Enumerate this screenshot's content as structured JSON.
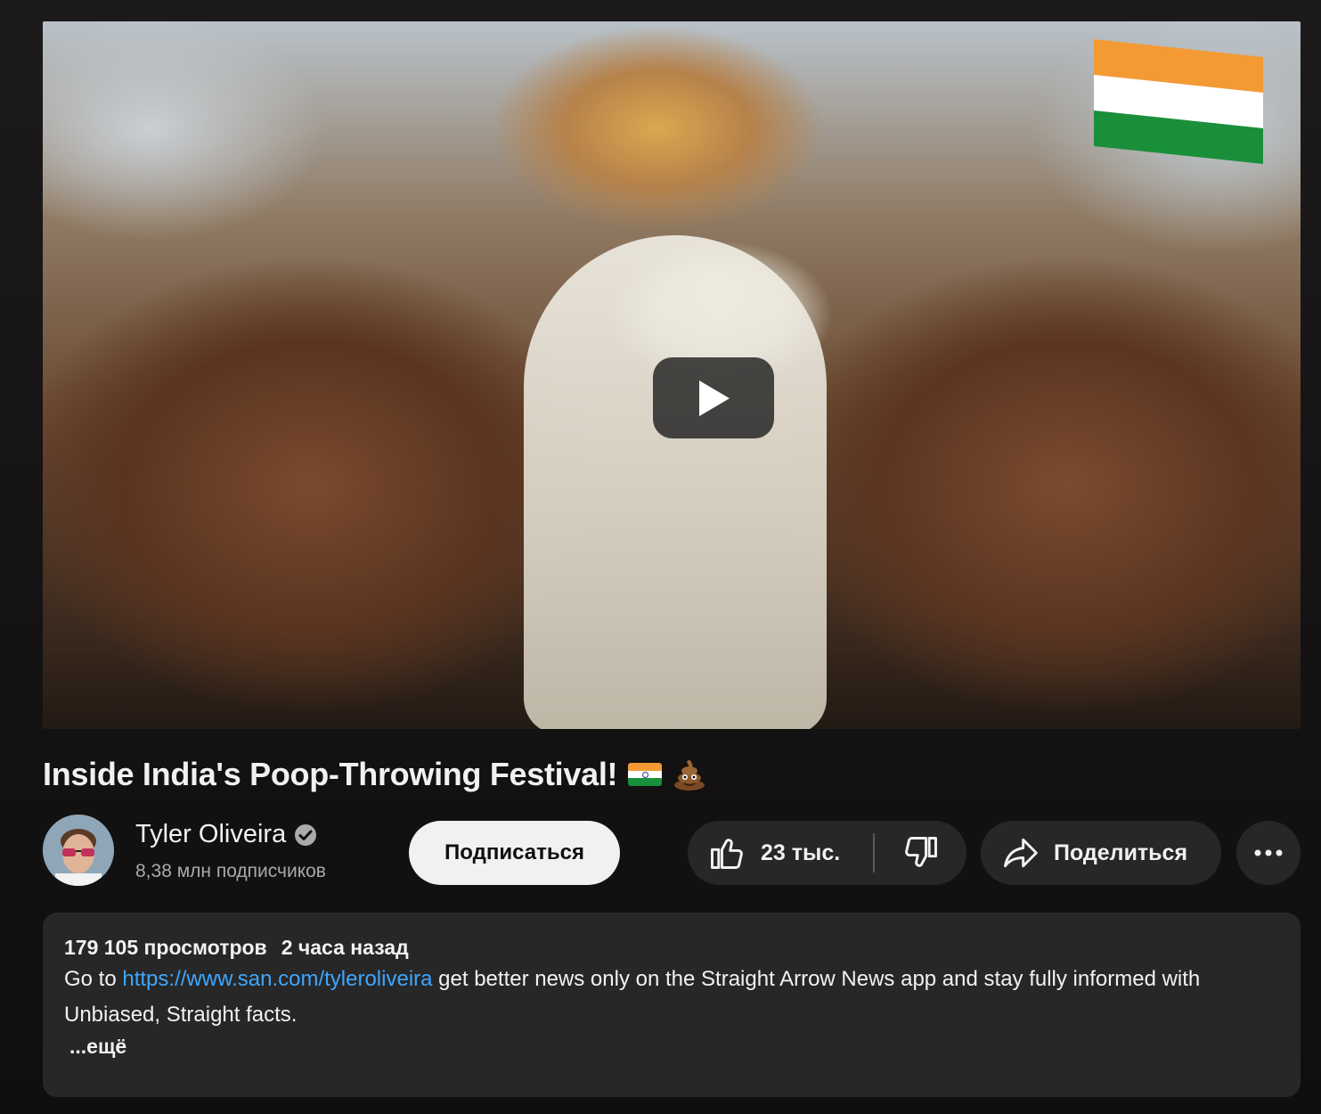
{
  "video": {
    "title": "Inside India's Poop-Throwing Festival!",
    "title_emojis": [
      "india-flag-icon",
      "pile-of-poo-icon"
    ],
    "thumbnail_description_icon": "video-thumbnail"
  },
  "channel": {
    "name": "Tyler Oliveira",
    "subscribers": "8,38 млн подписчиков",
    "verified": true
  },
  "actions": {
    "subscribe_label": "Подписаться",
    "like_count": "23 тыс.",
    "share_label": "Поделиться"
  },
  "description": {
    "views": "179 105 просмотров",
    "posted": "2 часа назад",
    "prefix": "Go to ",
    "link": "https://www.san.com/tyleroliveira",
    "suffix": " get better news only on the Straight Arrow News app and stay fully informed with Unbiased, Straight facts.",
    "more_label": "...ещё"
  },
  "colors": {
    "background": "#0f0f0f",
    "button_bg": "#272727",
    "link": "#3ea6ff",
    "subscribe_bg": "#f1f1f1",
    "secondary_text": "#aaaaaa"
  }
}
